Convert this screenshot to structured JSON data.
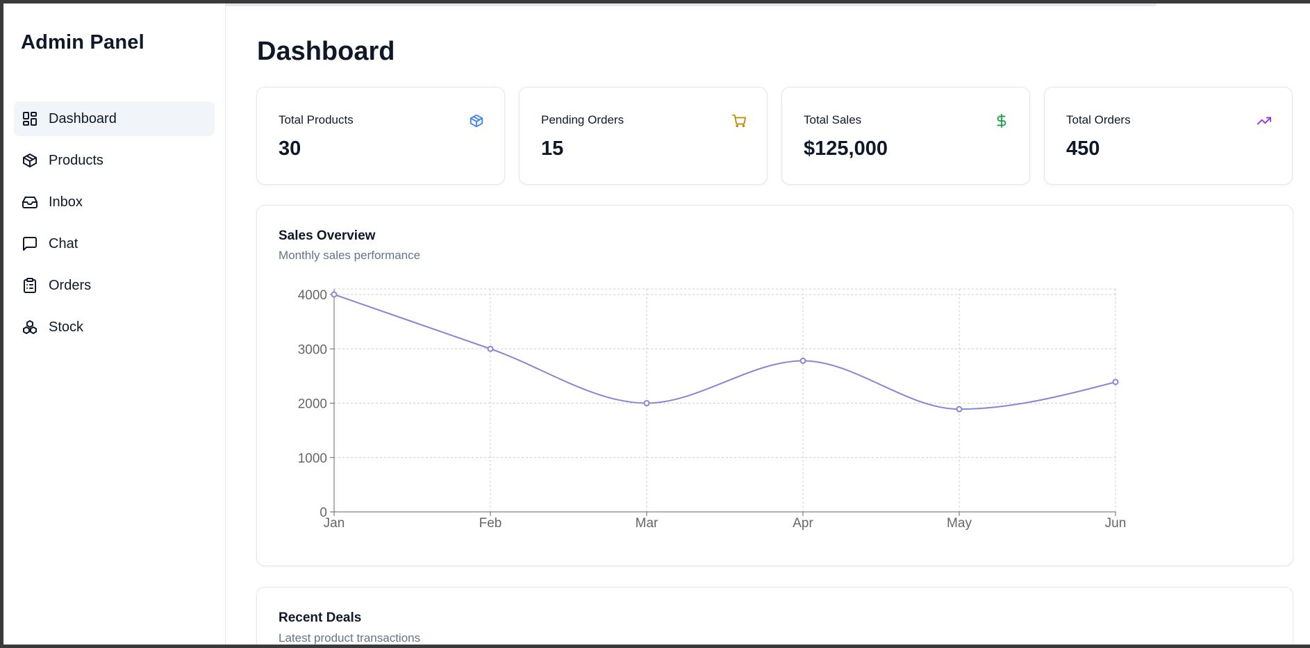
{
  "app": {
    "brand": "Admin Panel"
  },
  "sidebar": {
    "items": [
      {
        "label": "Dashboard",
        "icon": "layout-dashboard-icon",
        "active": true
      },
      {
        "label": "Products",
        "icon": "package-icon",
        "active": false
      },
      {
        "label": "Inbox",
        "icon": "inbox-icon",
        "active": false
      },
      {
        "label": "Chat",
        "icon": "message-square-icon",
        "active": false
      },
      {
        "label": "Orders",
        "icon": "clipboard-list-icon",
        "active": false
      },
      {
        "label": "Stock",
        "icon": "boxes-icon",
        "active": false
      }
    ]
  },
  "main": {
    "title": "Dashboard",
    "stats": [
      {
        "label": "Total Products",
        "value": "30",
        "icon": "package-icon",
        "color": "#3b82f6"
      },
      {
        "label": "Pending Orders",
        "value": "15",
        "icon": "shopping-cart-icon",
        "color": "#ca8a04"
      },
      {
        "label": "Total Sales",
        "value": "$125,000",
        "icon": "dollar-sign-icon",
        "color": "#16a34a"
      },
      {
        "label": "Total Orders",
        "value": "450",
        "icon": "trending-up-icon",
        "color": "#9333ea"
      }
    ],
    "sales_overview": {
      "title": "Sales Overview",
      "subtitle": "Monthly sales performance"
    },
    "recent_deals": {
      "title": "Recent Deals",
      "subtitle": "Latest product transactions"
    }
  },
  "chart_data": {
    "type": "line",
    "title": "Sales Overview",
    "subtitle": "Monthly sales performance",
    "categories": [
      "Jan",
      "Feb",
      "Mar",
      "Apr",
      "May",
      "Jun"
    ],
    "series": [
      {
        "values": [
          4000,
          3000,
          2000,
          2780,
          1890,
          2390
        ],
        "color": "#8884d8"
      }
    ],
    "ylim": [
      0,
      4000
    ],
    "yticks": [
      0,
      1000,
      2000,
      3000,
      4000
    ],
    "grid": true,
    "curve": "monotone"
  }
}
